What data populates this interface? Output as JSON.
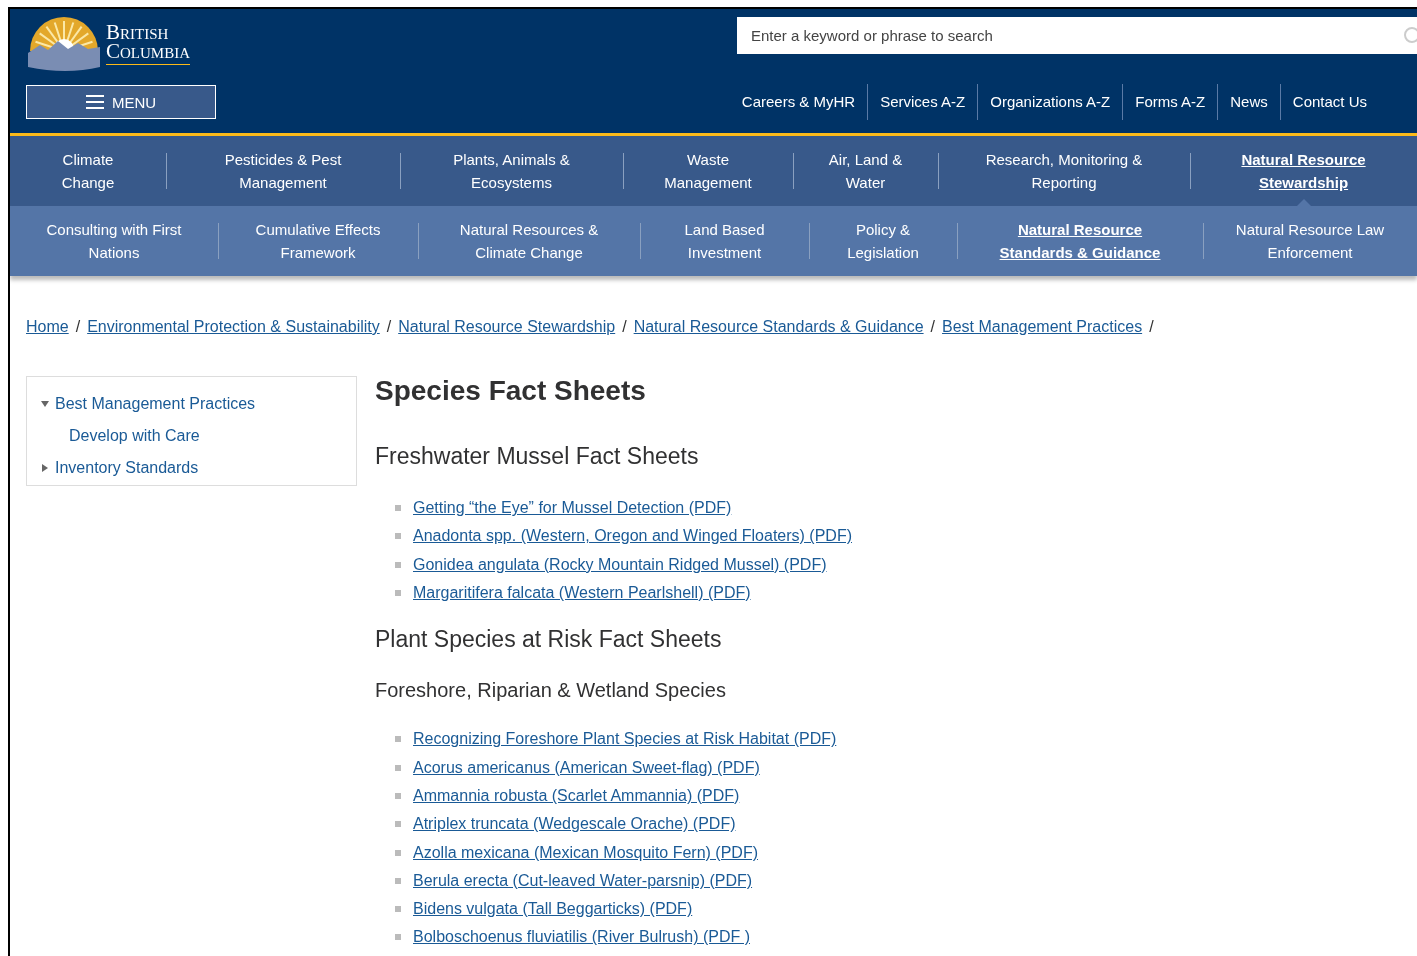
{
  "header": {
    "logo_text": [
      "British",
      "Columbia"
    ],
    "menu_button": "MENU",
    "search": {
      "placeholder": "Enter a keyword or phrase to search"
    },
    "utility_links": [
      "Careers & MyHR",
      "Services A-Z",
      "Organizations A-Z",
      "Forms A-Z",
      "News",
      "Contact Us"
    ]
  },
  "primary_nav": [
    {
      "label": "Climate Change",
      "selected": false
    },
    {
      "label": "Pesticides & Pest Management",
      "selected": false
    },
    {
      "label": "Plants, Animals & Ecosystems",
      "selected": false
    },
    {
      "label": "Waste Management",
      "selected": false
    },
    {
      "label": "Air, Land & Water",
      "selected": false
    },
    {
      "label": "Research, Monitoring & Reporting",
      "selected": false
    },
    {
      "label": "Natural Resource Stewardship",
      "selected": true
    }
  ],
  "secondary_nav": [
    {
      "label": "Consulting with First Nations",
      "selected": false
    },
    {
      "label": "Cumulative Effects Framework",
      "selected": false
    },
    {
      "label": "Natural Resources & Climate Change",
      "selected": false
    },
    {
      "label": "Land Based Investment",
      "selected": false
    },
    {
      "label": "Policy & Legislation",
      "selected": false
    },
    {
      "label": "Natural Resource Standards & Guidance",
      "selected": true
    },
    {
      "label": "Natural Resource Law Enforcement",
      "selected": false
    }
  ],
  "breadcrumb": {
    "separator": "/",
    "items": [
      "Home",
      "Environmental Protection & Sustainability",
      "Natural Resource Stewardship",
      "Natural Resource Standards & Guidance",
      "Best Management Practices"
    ]
  },
  "sidebar": {
    "items": [
      {
        "label": "Best Management Practices",
        "expanded": true,
        "children": [
          {
            "label": "Develop with Care"
          }
        ]
      },
      {
        "label": "Inventory Standards",
        "expanded": false
      }
    ]
  },
  "content": {
    "title": "Species Fact Sheets",
    "sections": [
      {
        "kind": "h2",
        "text": "Freshwater Mussel Fact Sheets"
      },
      {
        "kind": "links",
        "items": [
          "Getting “the Eye” for Mussel Detection (PDF)",
          "Anadonta spp. (Western, Oregon and Winged Floaters) (PDF)",
          "Gonidea angulata (Rocky Mountain Ridged Mussel) (PDF)",
          "Margaritifera falcata (Western Pearlshell) (PDF)"
        ]
      },
      {
        "kind": "h2",
        "text": "Plant Species at Risk Fact Sheets"
      },
      {
        "kind": "h3",
        "text": "Foreshore, Riparian & Wetland Species"
      },
      {
        "kind": "links",
        "items": [
          "Recognizing Foreshore Plant Species at Risk Habitat (PDF)",
          "Acorus americanus (American Sweet-flag) (PDF)",
          "Ammannia robusta (Scarlet Ammannia) (PDF)",
          "Atriplex truncata (Wedgescale Orache) (PDF)",
          "Azolla mexicana (Mexican Mosquito Fern) (PDF)",
          "Berula erecta (Cut-leaved Water-parsnip) (PDF)",
          "Bidens vulgata (Tall Beggarticks) (PDF)",
          "Bolboschoenus fluviatilis (River Bulrush) (PDF )"
        ]
      }
    ]
  }
}
